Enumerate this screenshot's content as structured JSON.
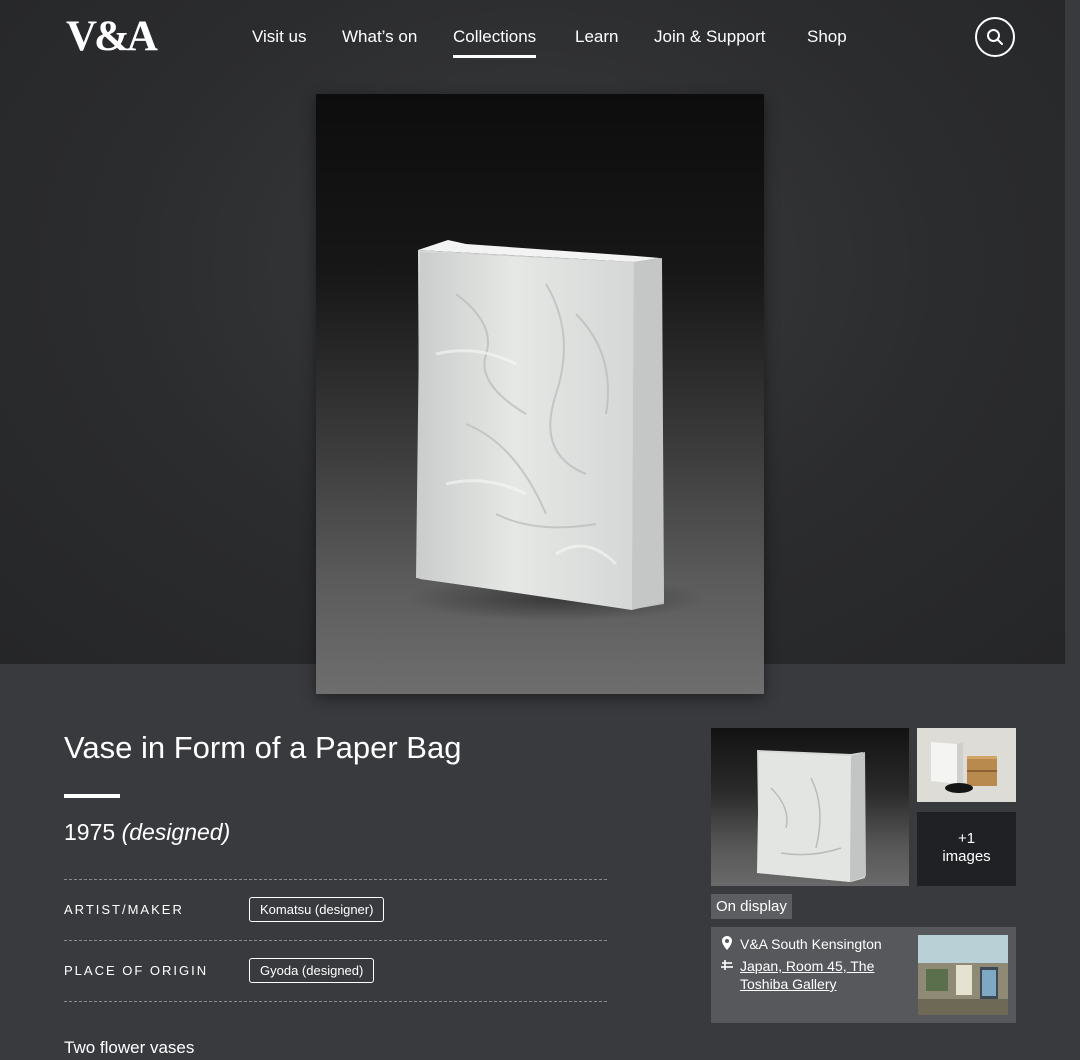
{
  "header": {
    "logo_text": "V&A",
    "nav": [
      {
        "label": "Visit us",
        "active": false
      },
      {
        "label": "What’s on",
        "active": false
      },
      {
        "label": "Collections",
        "active": true
      },
      {
        "label": "Learn",
        "active": false
      },
      {
        "label": "Join & Support",
        "active": false
      },
      {
        "label": "Shop",
        "active": false
      }
    ],
    "search_icon": "search-icon"
  },
  "object": {
    "title": "Vase in Form of a Paper Bag",
    "date": "1975",
    "date_qualifier": "(designed)",
    "details": [
      {
        "label": "ARTIST/MAKER",
        "value": "Komatsu (designer)"
      },
      {
        "label": "PLACE OF ORIGIN",
        "value": "Gyoda (designed)"
      }
    ],
    "description": "Two flower vases"
  },
  "gallery": {
    "more_images_count": "+1",
    "more_images_label": "images",
    "status_badge": "On display",
    "location_name": "V&A South Kensington",
    "location_room": "Japan, Room 45, The Toshiba Gallery",
    "pin_icon": "map-pin-icon",
    "room_icon": "gallery-room-icon"
  },
  "colors": {
    "page_background": "#393a3e",
    "hero_background": "#2b2c2e",
    "location_card": "#57585c",
    "text": "#ffffff"
  }
}
